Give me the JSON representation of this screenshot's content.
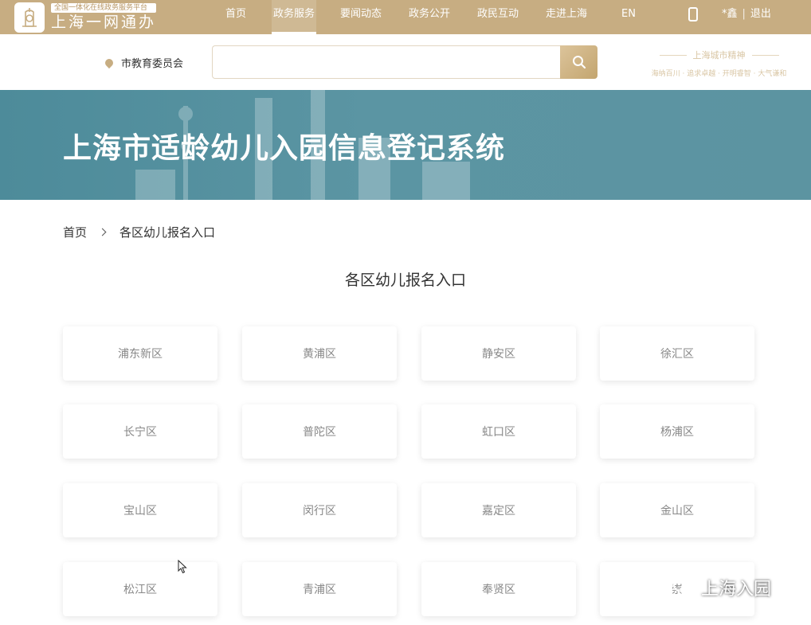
{
  "header": {
    "logo_tagline": "全国一体化在线政务服务平台",
    "logo_name": "上海一网通办",
    "nav": [
      {
        "label": "首页",
        "active": false
      },
      {
        "label": "政务服务",
        "active": true
      },
      {
        "label": "要闻动态",
        "active": false
      },
      {
        "label": "政务公开",
        "active": false
      },
      {
        "label": "政民互动",
        "active": false
      },
      {
        "label": "走进上海",
        "active": false
      },
      {
        "label": "EN",
        "active": false
      }
    ],
    "user_name": "*鑫",
    "logout": "退出",
    "separator": "|"
  },
  "search": {
    "location": "市教育委员会",
    "placeholder": "",
    "value": ""
  },
  "slogan": {
    "title": "上海城市精神",
    "subtitle": "海纳百川 · 追求卓越 · 开明睿智 · 大气谦和"
  },
  "banner": {
    "title": "上海市适龄幼儿入园信息登记系统"
  },
  "breadcrumb": {
    "home": "首页",
    "current": "各区幼儿报名入口"
  },
  "section": {
    "title": "各区幼儿报名入口"
  },
  "districts": [
    "浦东新区",
    "黄浦区",
    "静安区",
    "徐汇区",
    "长宁区",
    "普陀区",
    "虹口区",
    "杨浦区",
    "宝山区",
    "闵行区",
    "嘉定区",
    "金山区",
    "松江区",
    "青浦区",
    "奉贤区",
    "崇"
  ],
  "watermark": {
    "text": "上海入园"
  },
  "colors": {
    "brand_gold": "#c7ad82",
    "banner_teal": "#4d8b9a"
  }
}
